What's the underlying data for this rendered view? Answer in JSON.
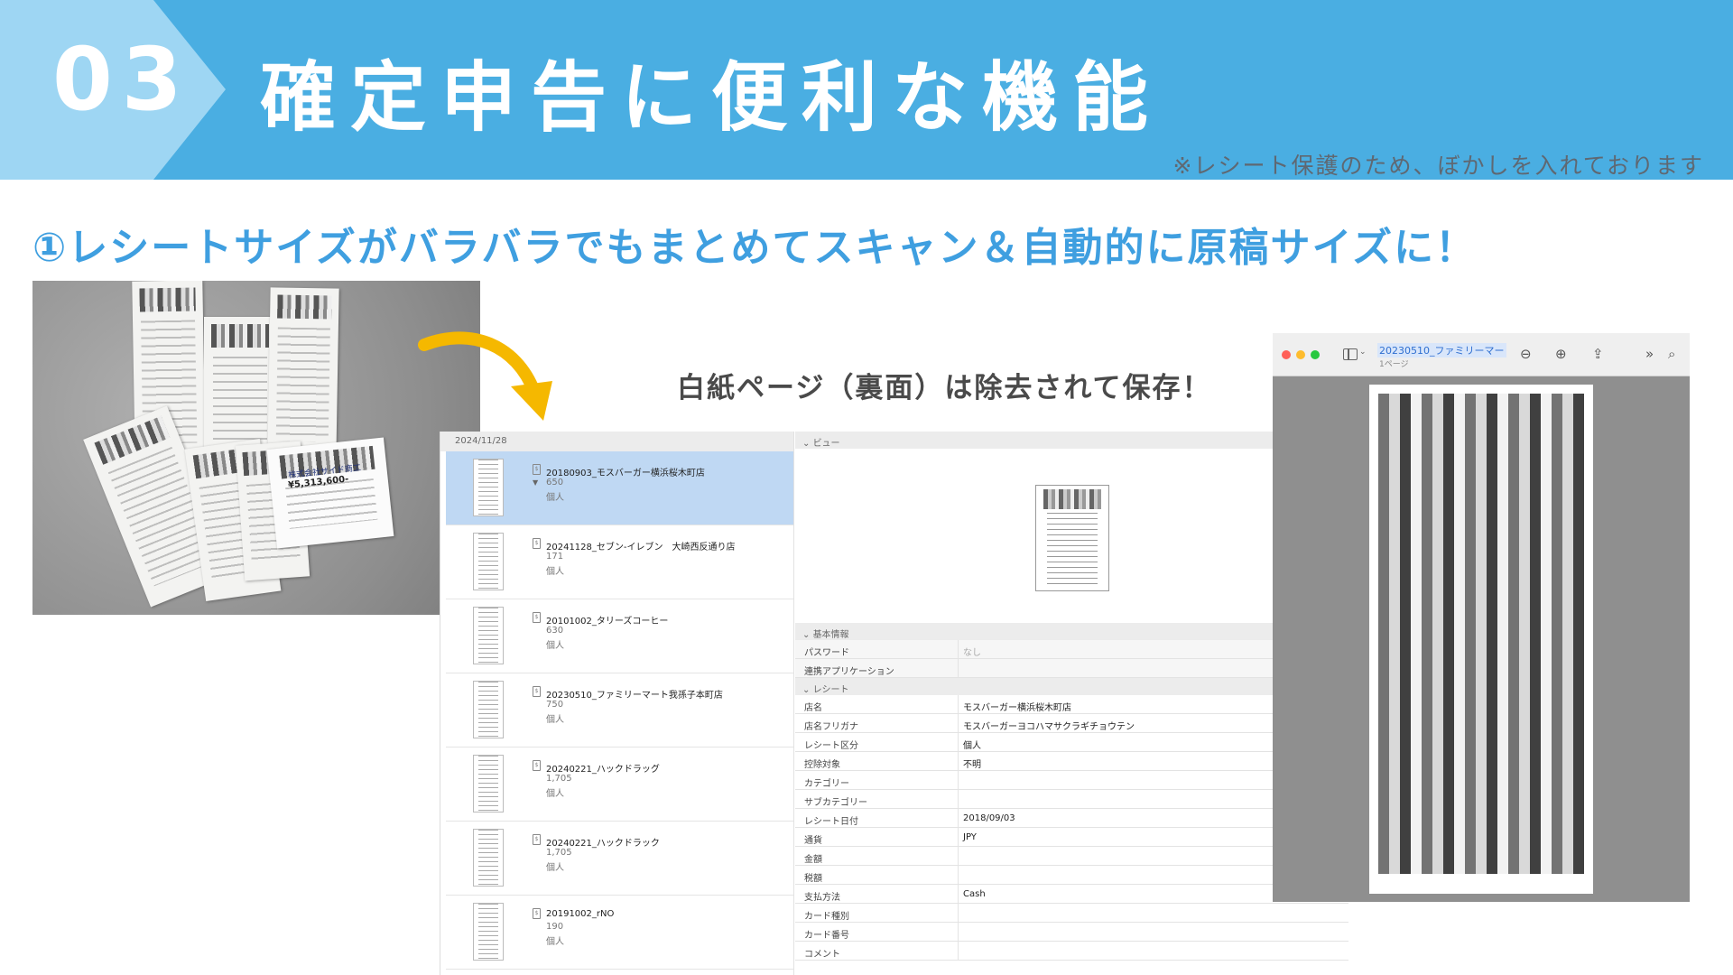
{
  "header": {
    "number": "03",
    "title": "確定申告に便利な機能",
    "note": "※レシート保護のため、ぼかしを入れております"
  },
  "subheading": "①レシートサイズがバラバラでもまとめてスキャン＆自動的に原稿サイズに！",
  "photo": {
    "amount": "¥5,313,600-",
    "company": "株式会社サイド商工"
  },
  "callout": "白紙ページ（裏面）は除去されて保存！",
  "list": {
    "date": "2024/11/28",
    "items": [
      {
        "title": "20180903_モスバーガー横浜桜木町店",
        "amount": "650",
        "type": "個人"
      },
      {
        "title": "20241128_セブン-イレブン　大崎西反通り店",
        "amount": "171",
        "type": "個人"
      },
      {
        "title": "20101002_タリーズコーヒー",
        "amount": "630",
        "type": "個人"
      },
      {
        "title": "20230510_ファミリーマート我孫子本町店",
        "amount": "750",
        "type": "個人"
      },
      {
        "title": "20240221_ハックドラッグ",
        "amount": "1,705",
        "type": "個人"
      },
      {
        "title": "20240221_ハックドラック",
        "amount": "1,705",
        "type": "個人"
      },
      {
        "title": "20191002_rNO",
        "amount": "190",
        "type": "個人"
      }
    ]
  },
  "detail": {
    "view_header": "ビュー",
    "basic_header": "基本情報",
    "basic": [
      {
        "key": "パスワード",
        "value": "なし"
      },
      {
        "key": "連携アプリケーション",
        "value": ""
      }
    ],
    "receipt_header": "レシート",
    "receipt": [
      {
        "key": "店名",
        "value": "モスバーガー横浜桜木町店"
      },
      {
        "key": "店名フリガナ",
        "value": "モスバーガーヨコハマサクラギチョウテン"
      },
      {
        "key": "レシート区分",
        "value": "個人"
      },
      {
        "key": "控除対象",
        "value": "不明"
      },
      {
        "key": "カテゴリー",
        "value": ""
      },
      {
        "key": "サブカテゴリー",
        "value": ""
      },
      {
        "key": "レシート日付",
        "value": "2018/09/03"
      },
      {
        "key": "通貨",
        "value": "JPY"
      },
      {
        "key": "金額",
        "value": ""
      },
      {
        "key": "税額",
        "value": ""
      },
      {
        "key": "支払方法",
        "value": "Cash"
      },
      {
        "key": "カード種別",
        "value": ""
      },
      {
        "key": "カード番号",
        "value": ""
      },
      {
        "key": "コメント",
        "value": ""
      }
    ]
  },
  "viewer": {
    "title": "20230510_ファミリーマー",
    "subtitle": "1ページ",
    "icons": [
      "sidebar-icon",
      "zoom-out-icon",
      "zoom-in-icon",
      "share-icon",
      "more-icon",
      "search-icon"
    ]
  },
  "colors": {
    "banner": "#4aaee2",
    "number_tab": "#9ed6f3",
    "subheading": "#3f9fe0",
    "arrow": "#f5b800",
    "selected_row": "#bfd8f3"
  }
}
